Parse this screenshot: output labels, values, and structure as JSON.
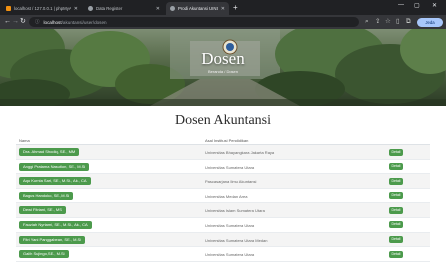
{
  "browser": {
    "tabs": [
      {
        "label": "localhost / 127.0.0.1 | phpMyAdmin",
        "favicon_color": "#f29111",
        "active": false
      },
      {
        "label": "Data Register",
        "favicon_color": "#9aa0a6",
        "active": false
      },
      {
        "label": "Prodi Akuntansi UINSU",
        "favicon_color": "#9aa0a6",
        "active": true
      }
    ],
    "new_tab_icon": "plus-icon",
    "url_host": "localhost",
    "url_path": "/akuntansi/user/dosen",
    "profile_label": "Jeda"
  },
  "hero": {
    "title": "Dosen",
    "subtitle": "Beranda  /  Dosen"
  },
  "page": {
    "title": "Dosen Akuntansi",
    "columns": {
      "name": "Nama",
      "institution": "Asal Institusi Pendidikan"
    },
    "rows": [
      {
        "name": "Dra. Ahmad Shodiq, SE., MM",
        "institution": "Universitas Bhayangkara Jakarta Raya",
        "action": "Detail"
      },
      {
        "name": "Anggi Pratama Nasution, SE., M.Si",
        "institution": "Universitas Sumatera Utara",
        "action": "Detail"
      },
      {
        "name": "Aqu Kurnia Sari, SE., M.Si., Ak., CA",
        "institution": "Pascasarjana Ilmu Akuntansi",
        "action": "Detail"
      },
      {
        "name": "Bagus Handoko, SE.,M.Si",
        "institution": "Universitas Medan Area",
        "action": "Detail"
      },
      {
        "name": "Dewi Fitriani, SE., MS",
        "institution": "Universitas Islam Sumatera Utara",
        "action": "Detail"
      },
      {
        "name": "Fauziah Nyrtami, SE., M.Si., Ak., CA",
        "institution": "Universitas Sumatera Utara",
        "action": "Detail"
      },
      {
        "name": "Fitri Yani Panggabean, SE., M.Si",
        "institution": "Universitas Sumatera Utara Medan",
        "action": "Detail"
      },
      {
        "name": "Galih Sujingo,SE., M.Si",
        "institution": "Universitas Sumatera Utara",
        "action": "Detail"
      }
    ]
  },
  "colors": {
    "accent_green": "#4c9a4c",
    "chrome_dark": "#202124",
    "chrome_toolbar": "#35363a"
  }
}
